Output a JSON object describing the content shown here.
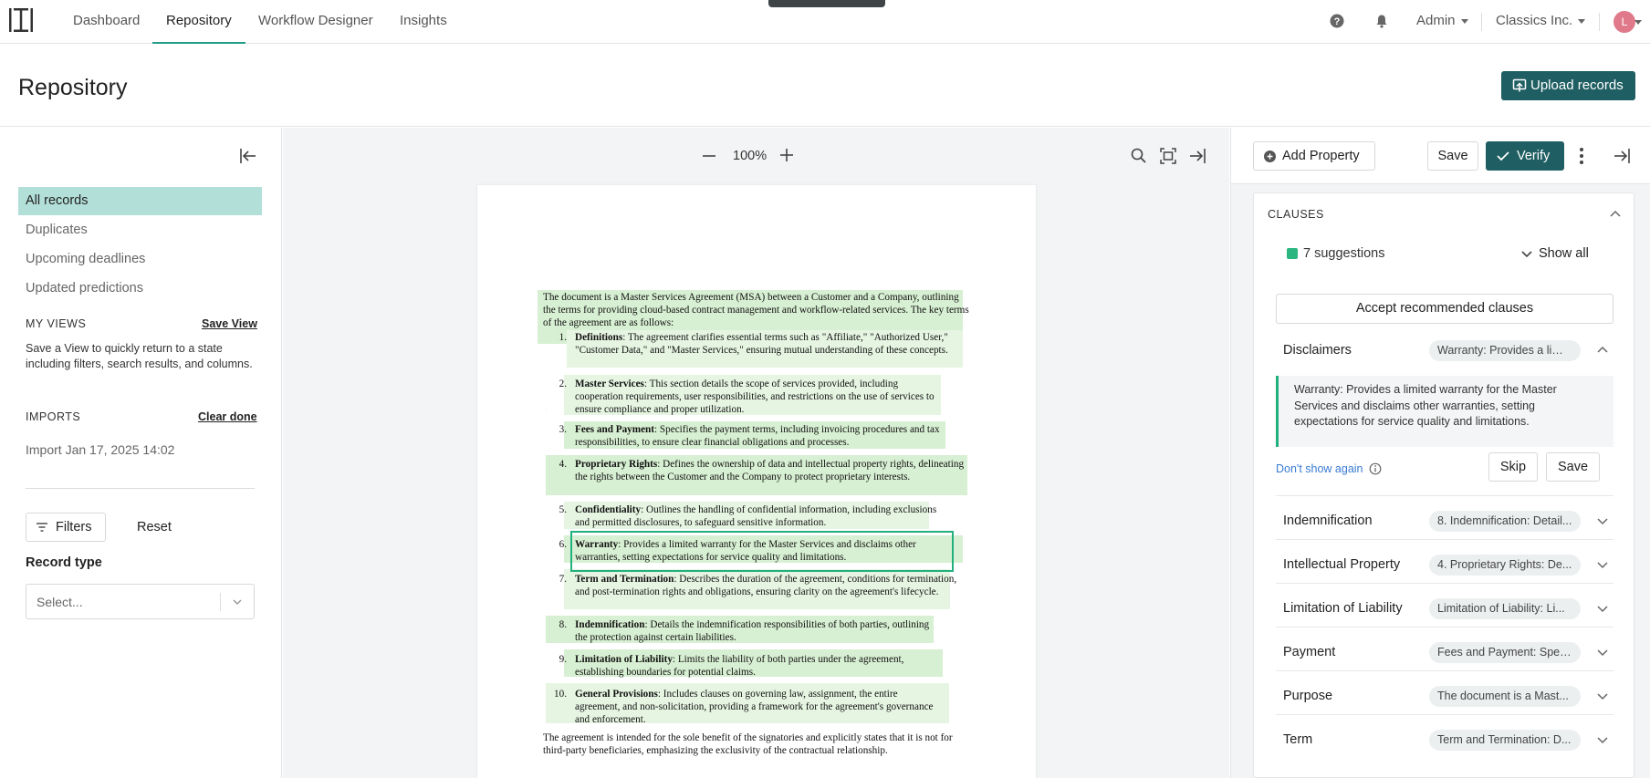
{
  "nav": {
    "tabs": [
      "Dashboard",
      "Repository",
      "Workflow Designer",
      "Insights"
    ],
    "active_tab": "Repository",
    "user_menu": "Admin",
    "org_menu": "Classics Inc.",
    "avatar_initial": "L"
  },
  "header": {
    "title": "Repository",
    "upload_label": "Upload records"
  },
  "sidebar": {
    "items": [
      "All records",
      "Duplicates",
      "Upcoming deadlines",
      "Updated predictions"
    ],
    "active_item": "All records",
    "my_views_heading": "MY VIEWS",
    "save_view_label": "Save View",
    "help_text": "Save a View to quickly return to a state including filters, search results, and columns.",
    "imports_heading": "IMPORTS",
    "clear_done_label": "Clear done",
    "import_item": "Import Jan 17, 2025 14:02",
    "filters_label": "Filters",
    "reset_label": "Reset",
    "record_type_label": "Record type",
    "record_type_placeholder": "Select..."
  },
  "viewer": {
    "zoom": "100%",
    "document": {
      "intro": "The document is a Master Services Agreement (MSA) between a Customer and a Company, outlining the terms for providing cloud-based contract management and workflow-related services. The key terms of the agreement are as follows:",
      "items": [
        {
          "num": "1.",
          "term": "Definitions",
          "text": ": The agreement clarifies essential terms such as \"Affiliate,\" \"Authorized User,\" \"Customer Data,\" and \"Master Services,\" ensuring mutual understanding of these concepts."
        },
        {
          "num": "2.",
          "term": "Master Services",
          "text": ": This section details the scope of services provided, including cooperation requirements, user responsibilities, and restrictions on the use of services to ensure compliance and proper utilization."
        },
        {
          "num": "3.",
          "term": "Fees and Payment",
          "text": ": Specifies the payment terms, including invoicing procedures and tax responsibilities, to ensure clear financial obligations and processes."
        },
        {
          "num": "4.",
          "term": "Proprietary Rights",
          "text": ": Defines the ownership of data and intellectual property rights, delineating the rights between the Customer and the Company to protect proprietary interests."
        },
        {
          "num": "5.",
          "term": "Confidentiality",
          "text": ": Outlines the handling of confidential information, including exclusions and permitted disclosures, to safeguard sensitive information."
        },
        {
          "num": "6.",
          "term": "Warranty",
          "text": ": Provides a limited warranty for the Master Services and disclaims other warranties, setting expectations for service quality and limitations."
        },
        {
          "num": "7.",
          "term": "Term and Termination",
          "text": ": Describes the duration of the agreement, conditions for termination, and post-termination rights and obligations, ensuring clarity on the agreement's lifecycle."
        },
        {
          "num": "8.",
          "term": "Indemnification",
          "text": ": Details the indemnification responsibilities of both parties, outlining the protection against certain liabilities."
        },
        {
          "num": "9.",
          "term": "Limitation of Liability",
          "text": ": Limits the liability of both parties under the agreement, establishing boundaries for potential claims."
        },
        {
          "num": "10.",
          "term": "General Provisions",
          "text": ": Includes clauses on governing law, assignment, the entire agreement, and non-solicitation, providing a framework for the agreement's governance and enforcement."
        }
      ],
      "outro": "The agreement is intended for the sole benefit of the signatories and explicitly states that it is not for third-party beneficiaries, emphasizing the exclusivity of the contractual relationship."
    }
  },
  "panel": {
    "add_property_label": "Add Property",
    "save_label": "Save",
    "verify_label": "Verify",
    "clauses_heading": "CLAUSES",
    "suggestions_label": "7 suggestions",
    "show_all_label": "Show all",
    "accept_label": "Accept recommended clauses",
    "expanded_text": "Warranty: Provides a limited warranty for the Master Services and disclaims other warranties, setting expectations for service quality and limitations.",
    "dont_show_label": "Don't show again",
    "skip_label": "Skip",
    "save2_label": "Save",
    "clauses": [
      {
        "label": "Disclaimers",
        "value": "Warranty: Provides a limi..."
      },
      {
        "label": "Indemnification",
        "value": "8. Indemnification: Detail..."
      },
      {
        "label": "Intellectual Property",
        "value": "4. Proprietary Rights: De..."
      },
      {
        "label": "Limitation of Liability",
        "value": "Limitation of Liability: Li..."
      },
      {
        "label": "Payment",
        "value": "Fees and Payment: Spec..."
      },
      {
        "label": "Purpose",
        "value": "The document is a Mast..."
      },
      {
        "label": "Term",
        "value": "Term and Termination: D..."
      }
    ]
  },
  "colors": {
    "accent": "#1f5e62",
    "active_nav_bg": "#b3dfd9",
    "highlight": "#d7efd2",
    "success": "#22b07d"
  }
}
